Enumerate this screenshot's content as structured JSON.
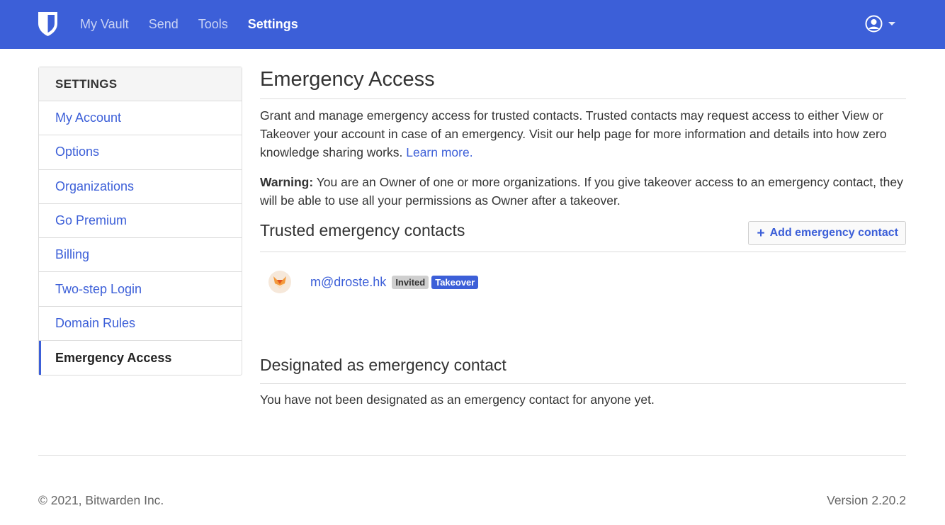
{
  "nav": {
    "links": [
      {
        "label": "My Vault"
      },
      {
        "label": "Send"
      },
      {
        "label": "Tools"
      },
      {
        "label": "Settings"
      }
    ],
    "brand_icon": "bitwarden-shield-icon",
    "account_icon": "user-circle-icon",
    "accent_color": "#3c5fd8"
  },
  "sidebar": {
    "header": "SETTINGS",
    "items": [
      {
        "label": "My Account"
      },
      {
        "label": "Options"
      },
      {
        "label": "Organizations"
      },
      {
        "label": "Go Premium"
      },
      {
        "label": "Billing"
      },
      {
        "label": "Two-step Login"
      },
      {
        "label": "Domain Rules"
      },
      {
        "label": "Emergency Access"
      }
    ]
  },
  "main": {
    "title": "Emergency Access",
    "description": "Grant and manage emergency access for trusted contacts. Trusted contacts may request access to either View or Takeover your account in case of an emergency. Visit our help page for more information and details into how zero knowledge sharing works.",
    "learn_more": "Learn more.",
    "warning_label": "Warning:",
    "warning_text": "You are an Owner of one or more organizations. If you give takeover access to an emergency contact, they will be able to use all your permissions as Owner after a takeover.",
    "trusted_title": "Trusted emergency contacts",
    "add_button": "Add emergency contact",
    "contacts": [
      {
        "email": "m@droste.hk",
        "status": "Invited",
        "type": "Takeover"
      }
    ],
    "designated_title": "Designated as emergency contact",
    "designated_empty": "You have not been designated as an emergency contact for anyone yet."
  },
  "footer": {
    "copyright": "© 2021, Bitwarden Inc.",
    "version": "Version 2.20.2"
  }
}
